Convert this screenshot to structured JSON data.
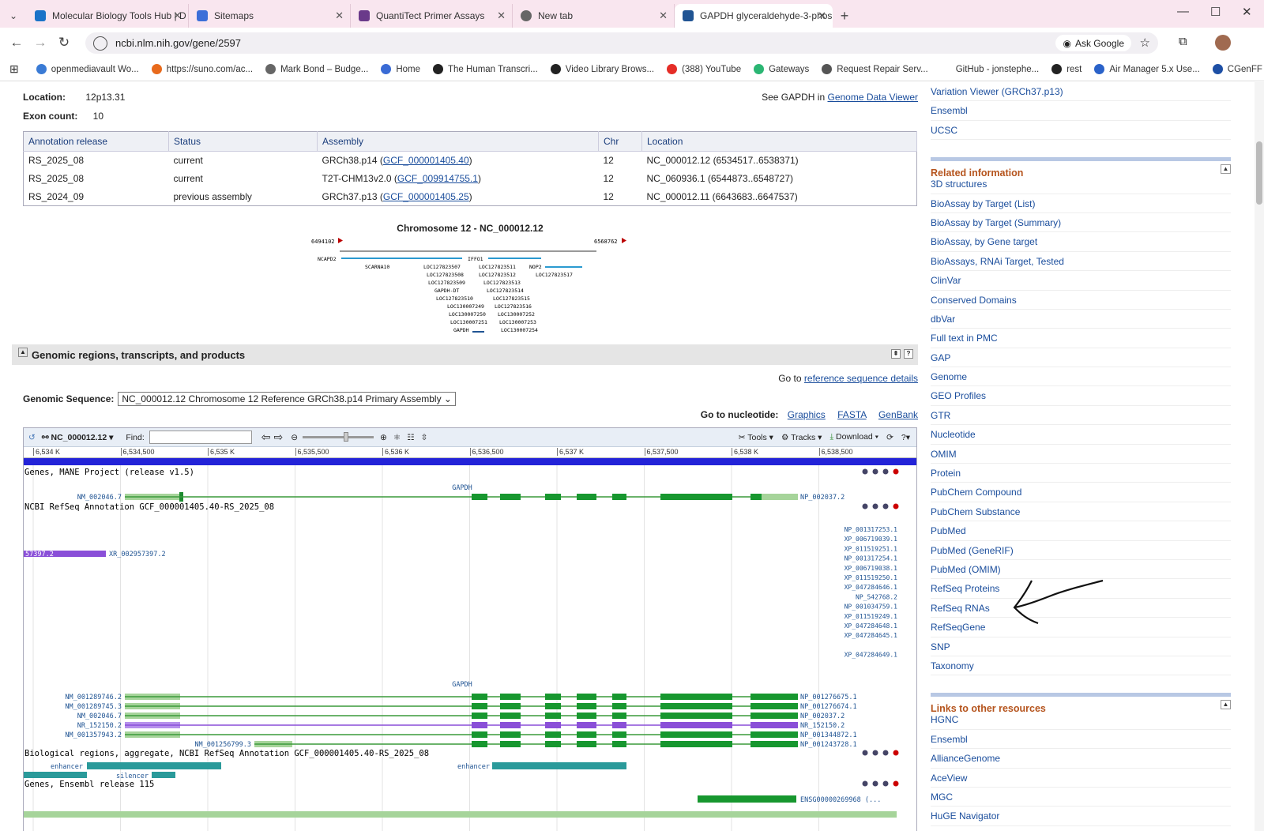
{
  "browser": {
    "tabs": [
      {
        "label": "Molecular Biology Tools Hub | D",
        "color": "#1a73c8"
      },
      {
        "label": "Sitemaps",
        "color": "#3c6fd8"
      },
      {
        "label": "QuantiTect Primer Assays",
        "color": "#6a3a8a"
      },
      {
        "label": "New tab",
        "color": "#666666"
      },
      {
        "label": "GAPDH glyceraldehyde-3-phos",
        "color": "#205493"
      }
    ],
    "url": "ncbi.nlm.nih.gov/gene/2597",
    "ask_google": "Ask Google",
    "bookmarks": [
      {
        "label": "openmediavault Wo...",
        "color": "#3a7bd5"
      },
      {
        "label": "https://suno.com/ac...",
        "color": "#e86a1c"
      },
      {
        "label": "Mark Bond – Budge...",
        "color": "#666666"
      },
      {
        "label": "Home",
        "color": "#3a6bd5"
      },
      {
        "label": "The Human Transcri...",
        "color": "#222222"
      },
      {
        "label": "Video Library Brows...",
        "color": "#222222"
      },
      {
        "label": "(388) YouTube",
        "color": "#e52d27"
      },
      {
        "label": "Gateways",
        "color": "#2bb673"
      },
      {
        "label": "Request Repair Serv...",
        "color": "#555555"
      },
      {
        "label": "GitHub - jonstephe...",
        "color": "#ffffff"
      },
      {
        "label": "rest",
        "color": "#222222"
      },
      {
        "label": "Air Manager 5.x Use...",
        "color": "#2a62c9"
      },
      {
        "label": "CGenFF",
        "color": "#1d4fa5"
      }
    ]
  },
  "gene": {
    "location_label": "Location:",
    "location": "12p13.31",
    "exon_label": "Exon count:",
    "exon_count": "10",
    "see_text": "See GAPDH in",
    "see_link": "Genome Data Viewer"
  },
  "annotation_table": {
    "headers": [
      "Annotation release",
      "Status",
      "Assembly",
      "Chr",
      "Location"
    ],
    "rows": [
      {
        "release": "RS_2025_08",
        "status": "current",
        "assembly": "GRCh38.p14",
        "accession": "GCF_000001405.40",
        "chr": "12",
        "location": "NC_000012.12 (6534517..6538371)"
      },
      {
        "release": "RS_2025_08",
        "status": "current",
        "assembly": "T2T-CHM13v2.0",
        "accession": "GCF_009914755.1",
        "chr": "12",
        "location": "NC_060936.1 (6544873..6548727)"
      },
      {
        "release": "RS_2024_09",
        "status": "previous assembly",
        "assembly": "GRCh37.p13",
        "accession": "GCF_000001405.25",
        "chr": "12",
        "location": "NC_000012.11 (6643683..6647537)"
      }
    ]
  },
  "chromosome_map": {
    "title": "Chromosome 12 - NC_000012.12",
    "left_coord": "6494102",
    "right_coord": "6568762",
    "genes": [
      "NCAPD2",
      "IFFO1",
      "SCARNA10",
      "LOC127823507",
      "LOC127823511",
      "NOP2",
      "LOC127823508",
      "LOC127823512",
      "LOC127823517",
      "LOC127823509",
      "LOC127823513",
      "GAPDH-DT",
      "LOC127823514",
      "LOC127823510",
      "LOC127823515",
      "LOC130007249",
      "LOC127823516",
      "LOC130007250",
      "LOC130007252",
      "LOC130007251",
      "LOC130007253",
      "GAPDH",
      "LOC130007254"
    ]
  },
  "section": {
    "title": "Genomic regions, transcripts, and products",
    "goto_text": "Go to",
    "goto_link": "reference sequence details",
    "genomic_seq_label": "Genomic Sequence:",
    "genomic_seq_value": "NC_000012.12 Chromosome 12 Reference GRCh38.p14 Primary Assembly",
    "goto_nuc": "Go to nucleotide:",
    "nuc_links": [
      "Graphics",
      "FASTA",
      "GenBank"
    ]
  },
  "viewer": {
    "seq": "NC_000012.12",
    "find_label": "Find:",
    "tools": "Tools",
    "tracks": "Tracks",
    "download": "Download",
    "ruler": [
      "6,534 K",
      "6,534,500",
      "6,535 K",
      "6,535,500",
      "6,536 K",
      "6,536,500",
      "6,537 K",
      "6,537,500",
      "6,538 K",
      "6,538,500"
    ],
    "track1": "Genes, MANE Project (release v1.5)",
    "gapdh": "GAPDH",
    "mane_left": "NM_002046.7",
    "mane_right": "NP_002037.2",
    "track2": "NCBI RefSeq Annotation GCF_000001405.40-RS_2025_08",
    "xr_left": "57397.2",
    "xr_right": "XR_002957397.2",
    "products": [
      "NP_001317253.1",
      "XP_006719039.1",
      "XP_011519251.1",
      "NP_001317254.1",
      "XP_006719038.1",
      "XP_011519250.1",
      "XP_047284646.1",
      "NP_542768.2",
      "NP_001034759.1",
      "XP_011519249.1",
      "XP_047284648.1",
      "XP_047284645.1",
      "XP_047284649.1"
    ],
    "transcripts": [
      {
        "left": "NM_001289746.2",
        "right": "NP_001276675.1"
      },
      {
        "left": "NM_001289745.3",
        "right": "NP_001276674.1"
      },
      {
        "left": "NM_002046.7",
        "right": "NP_002037.2"
      },
      {
        "left": "NR_152150.2",
        "right": "NR_152150.2"
      },
      {
        "left": "NM_001357943.2",
        "right": "NP_001344872.1"
      },
      {
        "left": "NM_001256799.3",
        "right": "NP_001243728.1"
      }
    ],
    "track3": "Biological regions, aggregate, NCBI RefSeq Annotation GCF_000001405.40-RS_2025_08",
    "enhancer": "enhancer",
    "silencer": "silencer",
    "track4": "Genes, Ensembl release 115",
    "ensembl": "ENSG00000269968 (..."
  },
  "right": {
    "top_links": [
      "Variation Viewer (GRCh37.p13)",
      "Ensembl",
      "UCSC"
    ],
    "related_title": "Related information",
    "related": [
      "3D structures",
      "BioAssay by Target (List)",
      "BioAssay by Target (Summary)",
      "BioAssay, by Gene target",
      "BioAssays, RNAi Target, Tested",
      "ClinVar",
      "Conserved Domains",
      "dbVar",
      "Full text in PMC",
      "GAP",
      "Genome",
      "GEO Profiles",
      "GTR",
      "Nucleotide",
      "OMIM",
      "Protein",
      "PubChem Compound",
      "PubChem Substance",
      "PubMed",
      "PubMed (GeneRIF)",
      "PubMed (OMIM)",
      "RefSeq Proteins",
      "RefSeq RNAs",
      "RefSeqGene",
      "SNP",
      "Taxonomy"
    ],
    "links_title": "Links to other resources",
    "links": [
      "HGNC",
      "Ensembl",
      "AllianceGenome",
      "AceView",
      "MGC",
      "HuGE Navigator"
    ]
  }
}
